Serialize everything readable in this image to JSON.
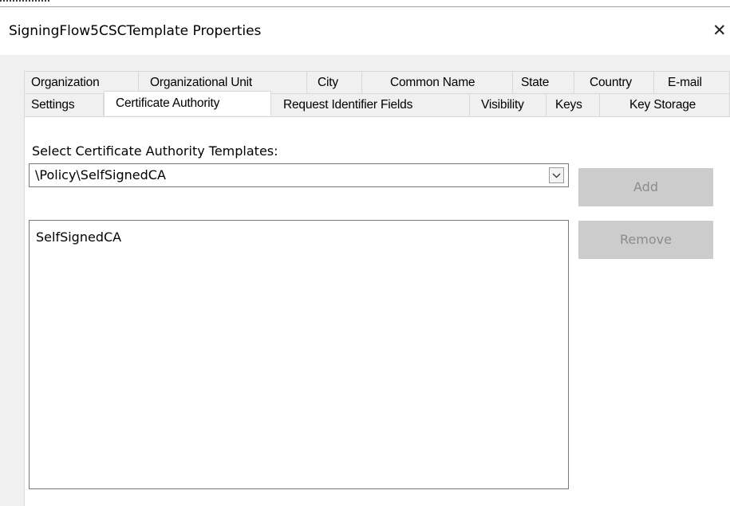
{
  "window": {
    "title": "SigningFlow5CSCTemplate Properties",
    "close_glyph": "✕"
  },
  "tabs": {
    "row_back": [
      "Organization",
      "Organizational Unit",
      "City",
      "Common Name",
      "State",
      "Country",
      "E-mail"
    ],
    "row_front": [
      "Settings",
      "Certificate Authority",
      "Request Identifier Fields",
      "Visibility",
      "Keys",
      "Key Storage"
    ],
    "selected": "Certificate Authority"
  },
  "panel": {
    "select_label": "Select Certificate Authority Templates:",
    "combo_value": "\\Policy\\SelfSignedCA",
    "add_label": "Add",
    "remove_label": "Remove",
    "list_items": [
      "SelfSignedCA"
    ]
  },
  "colors": {
    "client_bg": "#f0f0f0",
    "panel_bg": "#ffffff",
    "disabled_button_bg": "#cccccc",
    "disabled_button_text": "#8c8c8c"
  },
  "icons": {
    "close": "close-icon",
    "dropdown": "chevron-down-icon"
  }
}
